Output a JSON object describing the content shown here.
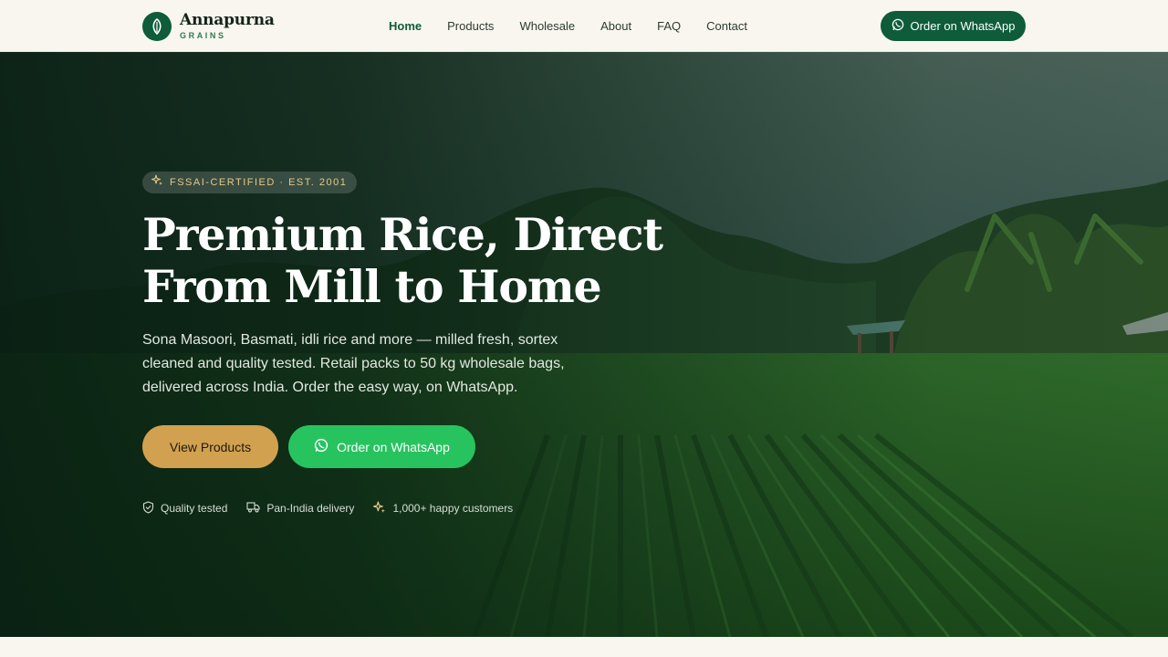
{
  "brand": {
    "name": "Annapurna",
    "tagline": "GRAINS"
  },
  "nav": {
    "items": [
      {
        "label": "Home",
        "active": true
      },
      {
        "label": "Products",
        "active": false
      },
      {
        "label": "Wholesale",
        "active": false
      },
      {
        "label": "About",
        "active": false
      },
      {
        "label": "FAQ",
        "active": false
      },
      {
        "label": "Contact",
        "active": false
      }
    ],
    "cta_label": "Order on WhatsApp"
  },
  "hero": {
    "badge": "FSSAI-CERTIFIED · EST. 2001",
    "title_line1": "Premium Rice, Direct",
    "title_line2": "From Mill to Home",
    "description": "Sona Masoori, Basmati, idli rice and more — milled fresh, sortex cleaned and quality tested. Retail packs to 50 kg wholesale bags, delivered across India. Order the easy way, on WhatsApp.",
    "primary_button": "View Products",
    "secondary_button": "Order on WhatsApp",
    "trust": [
      {
        "icon": "shield-check-icon",
        "label": "Quality tested"
      },
      {
        "icon": "truck-icon",
        "label": "Pan-India delivery"
      },
      {
        "icon": "sparkles-icon",
        "label": "1,000+ happy customers"
      }
    ]
  },
  "colors": {
    "brand_green": "#0e5c3a",
    "gold": "#d1a14f",
    "whatsapp_green": "#27c35f",
    "badge_text": "#e6c98a",
    "page_bg": "#f8f6ef"
  }
}
